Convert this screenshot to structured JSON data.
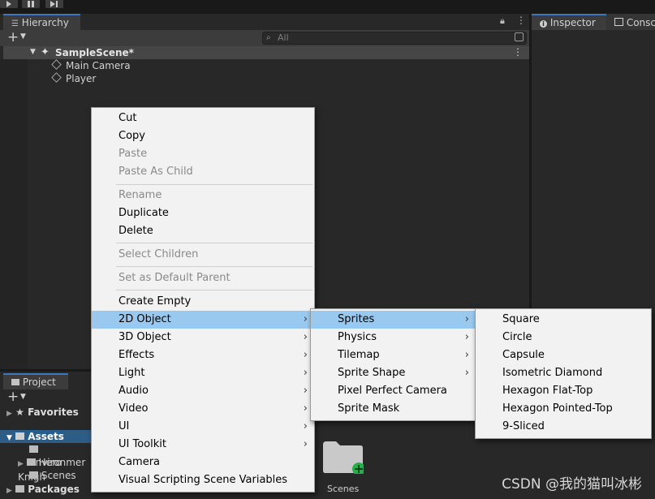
{
  "hierarchy": {
    "tab_label": "Hierarchy",
    "search_placeholder": "All",
    "scene_name": "SampleScene*",
    "objects": [
      "Main Camera",
      "Player"
    ]
  },
  "inspector": {
    "tabs": [
      "Inspector",
      "Consc"
    ]
  },
  "project": {
    "tab_label": "Project",
    "favorites_label": "Favorites",
    "assets_label": "Assets",
    "asset_folders": [
      "Environmer",
      "Hero Knigh",
      "Scenes"
    ],
    "packages_label": "Packages",
    "grid_folder_label": "Scenes"
  },
  "context_menu": {
    "items": [
      {
        "label": "Cut",
        "enabled": true
      },
      {
        "label": "Copy",
        "enabled": true
      },
      {
        "label": "Paste",
        "enabled": false
      },
      {
        "label": "Paste As Child",
        "enabled": false
      },
      {
        "label": "Rename",
        "enabled": false
      },
      {
        "label": "Duplicate",
        "enabled": true
      },
      {
        "label": "Delete",
        "enabled": true
      },
      {
        "label": "Select Children",
        "enabled": false
      },
      {
        "label": "Set as Default Parent",
        "enabled": false
      },
      {
        "label": "Create Empty",
        "enabled": true
      },
      {
        "label": "2D Object",
        "enabled": true,
        "submenu": true,
        "highlighted": true
      },
      {
        "label": "3D Object",
        "enabled": true,
        "submenu": true
      },
      {
        "label": "Effects",
        "enabled": true,
        "submenu": true
      },
      {
        "label": "Light",
        "enabled": true,
        "submenu": true
      },
      {
        "label": "Audio",
        "enabled": true,
        "submenu": true
      },
      {
        "label": "Video",
        "enabled": true,
        "submenu": true
      },
      {
        "label": "UI",
        "enabled": true,
        "submenu": true
      },
      {
        "label": "UI Toolkit",
        "enabled": true,
        "submenu": true
      },
      {
        "label": "Camera",
        "enabled": true
      },
      {
        "label": "Visual Scripting Scene Variables",
        "enabled": true
      }
    ]
  },
  "submenu_2d": {
    "items": [
      {
        "label": "Sprites",
        "submenu": true,
        "highlighted": true
      },
      {
        "label": "Physics",
        "submenu": true
      },
      {
        "label": "Tilemap",
        "submenu": true
      },
      {
        "label": "Sprite Shape",
        "submenu": true
      },
      {
        "label": "Pixel Perfect Camera"
      },
      {
        "label": "Sprite Mask"
      }
    ]
  },
  "submenu_sprites": {
    "items": [
      "Square",
      "Circle",
      "Capsule",
      "Isometric Diamond",
      "Hexagon Flat-Top",
      "Hexagon Pointed-Top",
      "9-Sliced"
    ]
  },
  "watermark": "CSDN @我的猫叫冰彬",
  "colors": {
    "menu_highlight": "#99c9ef",
    "tab_accent": "#3a79bb",
    "add_badge": "#21b14a"
  }
}
